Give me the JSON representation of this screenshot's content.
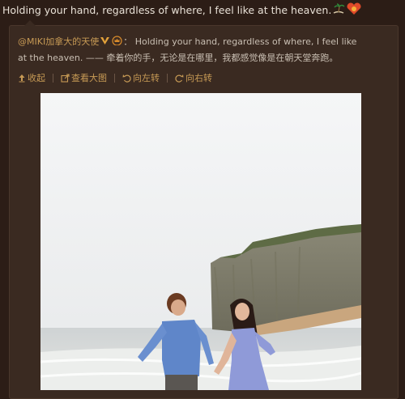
{
  "post": {
    "text": "Holding your hand, regardless of where, I feel like at the heaven.",
    "emoji_icons": [
      "palm-tree-icon",
      "heart-icon"
    ]
  },
  "repost": {
    "author": "@MIKI加拿大的天使",
    "author_badges": [
      "v-badge-icon",
      "crown-badge-icon"
    ],
    "colon": "：",
    "text": "Holding your hand, regardless of where, I feel like at the heaven. —— 牵着你的手，无论是在哪里，我都感觉像是在朝天堂奔跑。"
  },
  "toolbar": {
    "collapse": "收起",
    "view_large": "查看大图",
    "rotate_left": "向左转",
    "rotate_right": "向右转"
  },
  "colors": {
    "background": "#2c1d16",
    "panel": "#3a2a21",
    "link": "#c79a55",
    "text": "#e8e0d6"
  }
}
